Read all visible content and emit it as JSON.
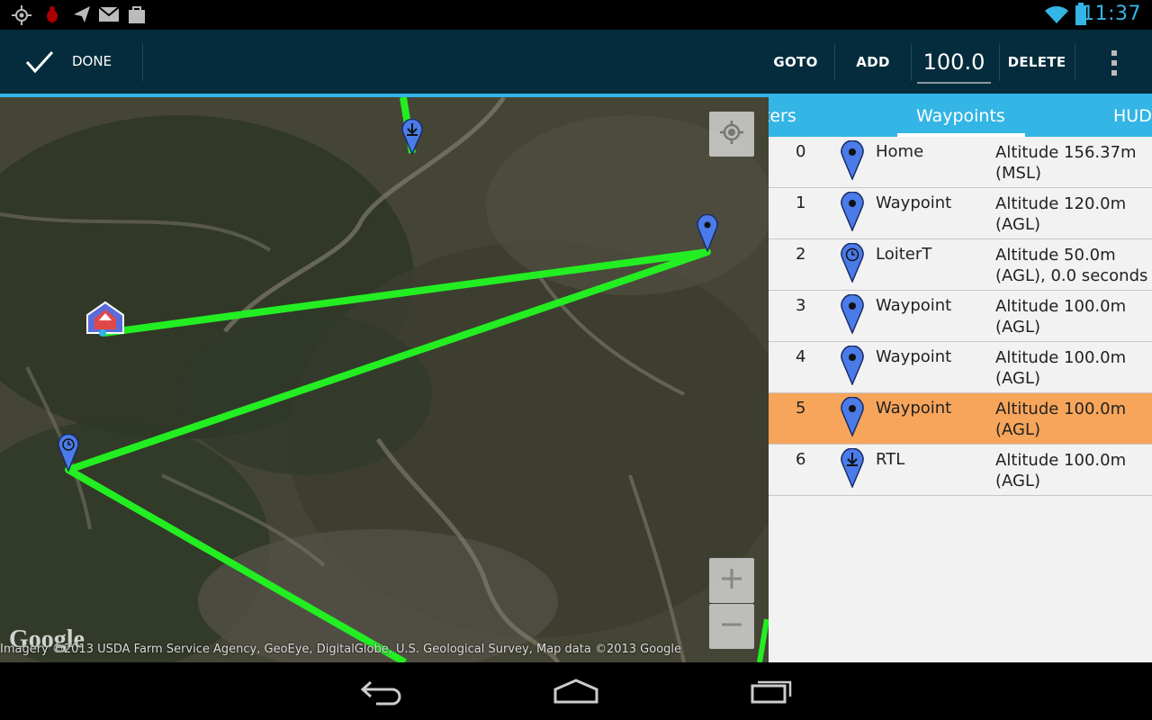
{
  "status_bar": {
    "time": "11:37"
  },
  "action_bar": {
    "done_label": "DONE",
    "goto_label": "GOTO",
    "add_label": "ADD",
    "altitude_value": "100.0",
    "delete_label": "DELETE"
  },
  "map": {
    "attribution": "Imagery ©2013 USDA Farm Service Agency, GeoEye, DigitalGlobe, U.S. Geological Survey, Map data ©2013 Google",
    "logo": "Google"
  },
  "tabs": [
    {
      "label": "Parameters"
    },
    {
      "label": "Waypoints"
    },
    {
      "label": "HUD"
    }
  ],
  "waypoints": [
    {
      "num": "0",
      "type": "Home",
      "line1": "Altitude 156.37m",
      "line2": "(MSL)",
      "icon": "pin-icon"
    },
    {
      "num": "1",
      "type": "Waypoint",
      "line1": "Altitude 120.0m",
      "line2": "(AGL)",
      "icon": "pin-icon"
    },
    {
      "num": "2",
      "type": "LoiterT",
      "line1": "Altitude 50.0m",
      "line2": "(AGL), 0.0 seconds",
      "icon": "loiter-pin-icon"
    },
    {
      "num": "3",
      "type": "Waypoint",
      "line1": "Altitude 100.0m",
      "line2": "(AGL)",
      "icon": "pin-icon"
    },
    {
      "num": "4",
      "type": "Waypoint",
      "line1": "Altitude 100.0m",
      "line2": "(AGL)",
      "icon": "pin-icon"
    },
    {
      "num": "5",
      "type": "Waypoint",
      "line1": "Altitude 100.0m",
      "line2": "(AGL)",
      "icon": "pin-icon",
      "selected": true
    },
    {
      "num": "6",
      "type": "RTL",
      "line1": "Altitude 100.0m",
      "line2": "(AGL)",
      "icon": "rtl-pin-icon"
    }
  ],
  "colors": {
    "accent": "#33b5e5",
    "selected_row": "#f6a55a",
    "path": "#22ee22",
    "actionbar": "#042c3c"
  }
}
